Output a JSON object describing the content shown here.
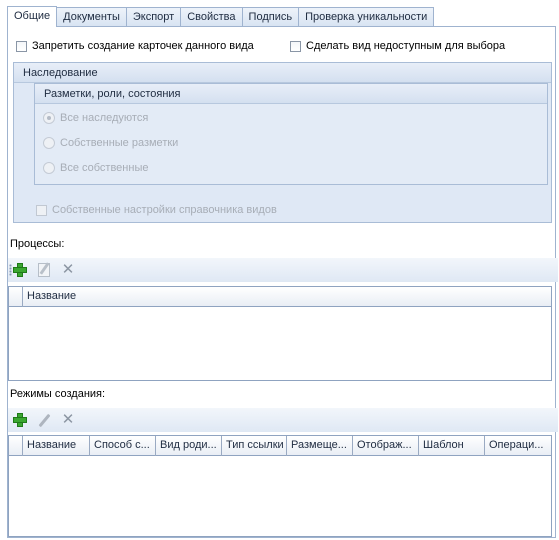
{
  "tabs": [
    {
      "label": "Общие",
      "active": true
    },
    {
      "label": "Документы",
      "active": false
    },
    {
      "label": "Экспорт",
      "active": false
    },
    {
      "label": "Свойства",
      "active": false
    },
    {
      "label": "Подпись",
      "active": false
    },
    {
      "label": "Проверка уникальности",
      "active": false
    }
  ],
  "options": {
    "forbid_cards": "Запретить создание карточек данного вида",
    "make_unavailable": "Сделать вид недоступным для выбора"
  },
  "inheritance": {
    "title": "Наследование",
    "markup_group": {
      "title": "Разметки, роли, состояния",
      "radios": [
        "Все наследуются",
        "Собственные разметки",
        "Все собственные"
      ],
      "selected_index": 0
    },
    "own_settings": "Собственные настройки справочника видов"
  },
  "processes": {
    "label": "Процессы:",
    "columns": [
      "Название"
    ]
  },
  "creation_modes": {
    "label": "Режимы создания:",
    "columns": [
      "Название",
      "Способ с...",
      "Вид роди...",
      "Тип ссылки",
      "Размеще...",
      "Отображ...",
      "Шаблон",
      "Операци..."
    ]
  },
  "icons": {
    "add": "plus-icon",
    "edit": "edit-icon",
    "delete": "delete-icon"
  },
  "colors": {
    "tab_border": "#9fb3cf",
    "group_bg": "#dfe8f5",
    "add_green": "#3aa630"
  }
}
